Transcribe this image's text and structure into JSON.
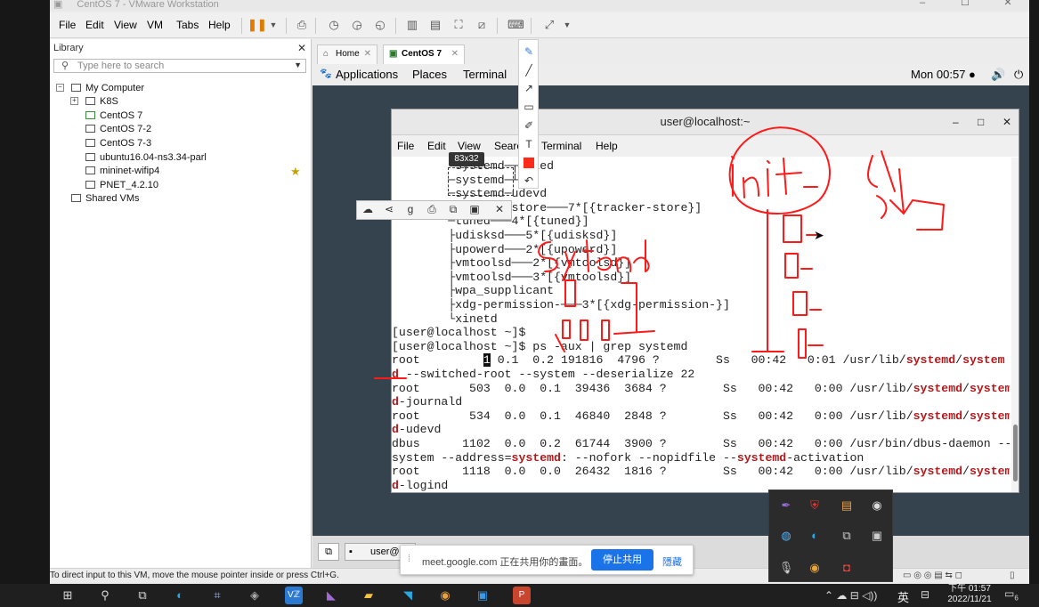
{
  "vmware": {
    "title": "CentOS 7 - VMware Workstation",
    "menu": [
      "File",
      "Edit",
      "View",
      "VM",
      "Tabs",
      "Help"
    ],
    "status_text": "To direct input to this VM, move the mouse pointer inside or press Ctrl+G."
  },
  "library": {
    "header": "Library",
    "search_placeholder": "Type here to search",
    "root": "My Computer",
    "items": [
      "K8S",
      "CentOS 7",
      "CentOS 7-2",
      "CentOS 7-3",
      "ubuntu16.04-ns3.34-parl",
      "mininet-wifip4",
      "PNET_4.2.10"
    ],
    "shared": "Shared VMs"
  },
  "tabs": [
    {
      "label": "Home"
    },
    {
      "label": "CentOS 7"
    }
  ],
  "gnome": {
    "applications": "Applications",
    "places": "Places",
    "terminal": "Terminal",
    "clock": "Mon 00:57 ●"
  },
  "terminal": {
    "title": "user@localhost:~",
    "menu": [
      "File",
      "Edit",
      "View",
      "Search",
      "Terminal",
      "Help"
    ],
    "lines": [
      "        └systemd─┬ealed",
      "        ─systemd─┴ind",
      "        ─systemd─udevd",
      "        ─tracker-store───7*[{tracker-store}]",
      "        ─tuned───4*[{tuned}]",
      "        ├udisksd───5*[{udisksd}]",
      "        ├upowerd───2*[{upowerd}]",
      "        ├vmtoolsd───2*[{vmtoolsd}]",
      "        ├vmtoolsd───3*[{vmtoolsd}]",
      "        ├wpa_supplicant",
      "        ├xdg-permission-───3*[{xdg-permission-}]",
      "        └xinetd",
      "[user@localhost ~]$",
      "[user@localhost ~]$ ps -aux | grep systemd"
    ],
    "ps_rows": [
      {
        "pre": "root         ",
        "pid": "1",
        "mid": " 0.1  0.2 191816  4796 ?        Ss   00:42   0:01 /usr/lib/",
        "hl1": "systemd",
        "slash": "/",
        "hl2": "system",
        "cont_hl": "d",
        "cont": " --switched-root --system --deserialize 22"
      },
      {
        "pre": "root       503",
        "pid": "",
        "mid": "  0.0  0.1  39436  3684 ?        Ss   00:42   0:00 /usr/lib/",
        "hl1": "systemd",
        "slash": "/",
        "hl2": "system",
        "cont_hl": "d",
        "cont": "-journald"
      },
      {
        "pre": "root       534",
        "pid": "",
        "mid": "  0.0  0.1  46840  2848 ?        Ss   00:42   0:00 /usr/lib/",
        "hl1": "systemd",
        "slash": "/",
        "hl2": "system",
        "cont_hl": "d",
        "cont": "-udevd"
      }
    ],
    "dbus_line1": "dbus      1102  0.0  0.2  61744  3900 ?        Ss   00:42   0:00 /usr/bin/dbus-daemon --",
    "dbus_line2_a": "system --address=",
    "dbus_line2_hl": "systemd",
    "dbus_line2_b": ": --nofork --nopidfile --",
    "dbus_line2_hl2": "systemd",
    "dbus_line2_c": "-activation",
    "login_row": {
      "pre": "root      1118  0.0  0.0  26432  1816 ?        Ss   00:42   0:00 /usr/lib/",
      "hl1": "systemd",
      "slash": "/",
      "hl2": "system",
      "cont_hl": "d",
      "cont": "-logind"
    }
  },
  "overlay": {
    "size_badge": "83x32",
    "share_text": "meet.google.com 正在共用你的畫面。",
    "share_button": "停止共用",
    "hide_button": "隱藏"
  },
  "taskbar": {
    "ime": "英",
    "time": "下午 01:57",
    "date": "2022/11/21",
    "notif": "6",
    "guest_task": "user@"
  },
  "colors": {
    "highlight": "#b3181b",
    "ink": "#ff1a1a",
    "share_blue": "#1a73e8"
  }
}
